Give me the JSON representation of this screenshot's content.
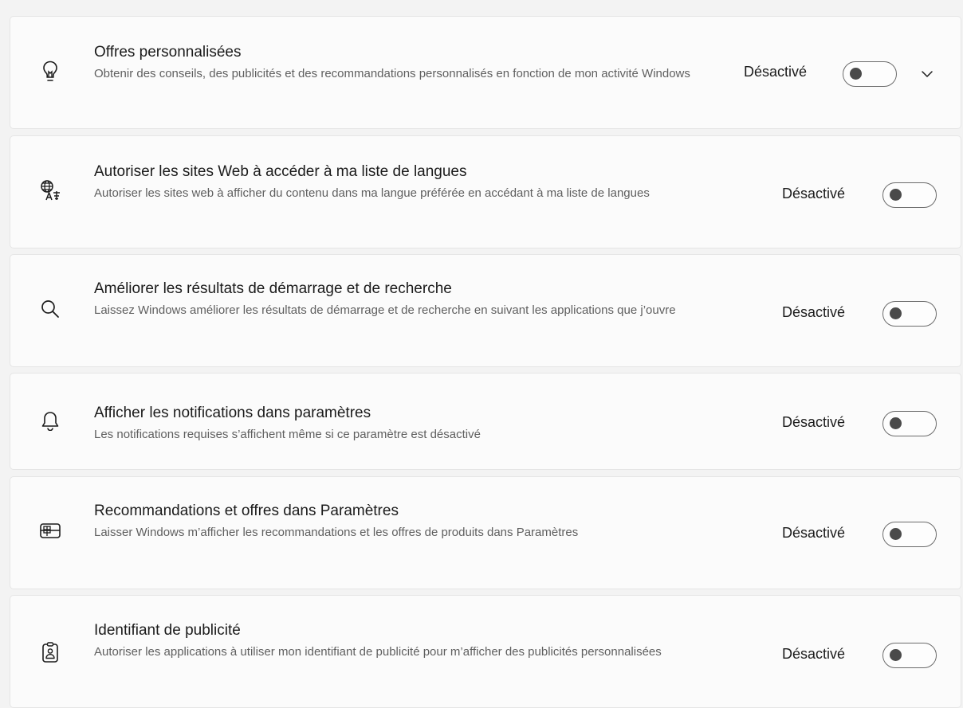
{
  "settings": [
    {
      "icon": "lightbulb-icon",
      "title": "Offres personnalisées",
      "description": "Obtenir des conseils, des publicités et des recommandations personnalisés en fonction de mon activité Windows",
      "state_label": "Désactivé",
      "enabled": false,
      "expandable": true
    },
    {
      "icon": "language-globe-icon",
      "title": "Autoriser les sites Web à accéder à ma liste de langues",
      "description": "Autoriser les sites web à afficher du contenu dans ma langue préférée en accédant à ma liste de langues",
      "state_label": "Désactivé",
      "enabled": false,
      "expandable": false
    },
    {
      "icon": "search-icon",
      "title": "Améliorer les résultats de démarrage et de recherche",
      "description": "Laissez Windows améliorer les résultats de démarrage et de recherche en suivant les applications que j’ouvre",
      "state_label": "Désactivé",
      "enabled": false,
      "expandable": false
    },
    {
      "icon": "bell-icon",
      "title": "Afficher les notifications dans paramètres",
      "description": "Les notifications requises s’affichent même si ce paramètre est désactivé",
      "state_label": "Désactivé",
      "enabled": false,
      "expandable": false
    },
    {
      "icon": "settings-offers-icon",
      "title": "Recommandations et offres dans Paramètres",
      "description": "Laisser Windows m’afficher les recommandations et les offres de produits dans Paramètres",
      "state_label": "Désactivé",
      "enabled": false,
      "expandable": false
    },
    {
      "icon": "advertising-id-icon",
      "title": "Identifiant de publicité",
      "description": "Autoriser les applications à utiliser mon identifiant de publicité pour m’afficher des publicités personnalisées",
      "state_label": "Désactivé",
      "enabled": false,
      "expandable": false
    }
  ]
}
